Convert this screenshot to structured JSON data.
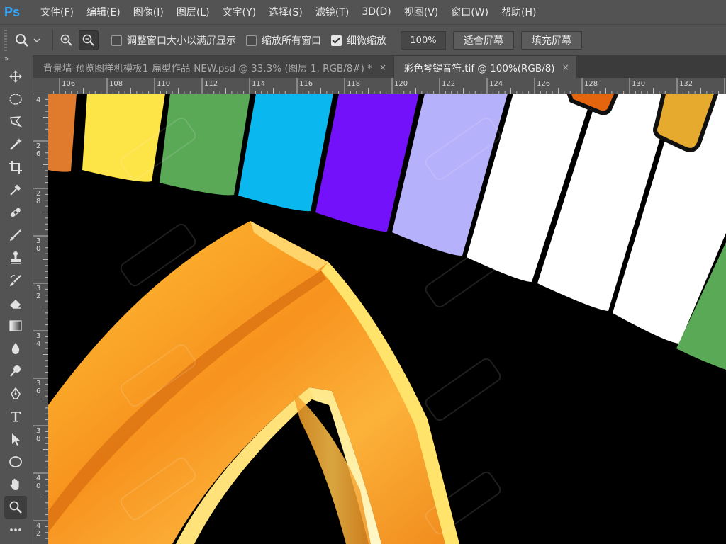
{
  "app": {
    "logo": "Ps"
  },
  "menu": [
    "文件(F)",
    "编辑(E)",
    "图像(I)",
    "图层(L)",
    "文字(Y)",
    "选择(S)",
    "滤镜(T)",
    "3D(D)",
    "视图(V)",
    "窗口(W)",
    "帮助(H)"
  ],
  "options": {
    "resize_windows": "调整窗口大小以满屏显示",
    "zoom_all": "缩放所有窗口",
    "scrubby_zoom": "细微缩放",
    "zoom_value": "100%",
    "fit_screen": "适合屏幕",
    "fill_screen": "填充屏幕",
    "resize_checked": false,
    "zoom_all_checked": false,
    "scrubby_checked": true
  },
  "tabs": [
    {
      "title": "背景墙-预览图样机模板1-扁型作品-NEW.psd @ 33.3% (图层 1, RGB/8#) *",
      "close": "×"
    },
    {
      "title": "彩色琴键音符.tif @ 100%(RGB/8)",
      "close": "×"
    }
  ],
  "ruler_top": [
    "106",
    "108",
    "110",
    "112",
    "114",
    "116",
    "118",
    "120",
    "122",
    "124",
    "126",
    "128",
    "130",
    "132"
  ],
  "ruler_left": [
    "4",
    "2\n6",
    "2\n8",
    "3\n0",
    "3\n2",
    "3\n4",
    "3\n6",
    "3\n8",
    "4\n0",
    "4\n2"
  ],
  "tools": [
    "move-icon",
    "ellipse-marquee-icon",
    "lasso-icon",
    "magic-wand-icon",
    "crop-icon",
    "eyedropper-icon",
    "healing-brush-icon",
    "brush-icon",
    "stamp-icon",
    "history-brush-icon",
    "eraser-icon",
    "gradient-icon",
    "blur-icon",
    "dodge-icon",
    "pen-icon",
    "type-icon",
    "path-select-icon",
    "shape-icon",
    "hand-icon",
    "zoom-icon",
    "more-icon"
  ],
  "toolbar_header": "»",
  "colors": {
    "accent": "#31a8ff",
    "panel": "#535353",
    "key_orange": "#e07a2c",
    "key_yellow": "#fde447",
    "key_green": "#5aa957",
    "key_cyan": "#0ab7ee",
    "key_violet": "#7312fa",
    "key_lavender": "#b6b1fb",
    "key_gold": "#e6aa2f",
    "note_orange": "#f29a2a"
  }
}
